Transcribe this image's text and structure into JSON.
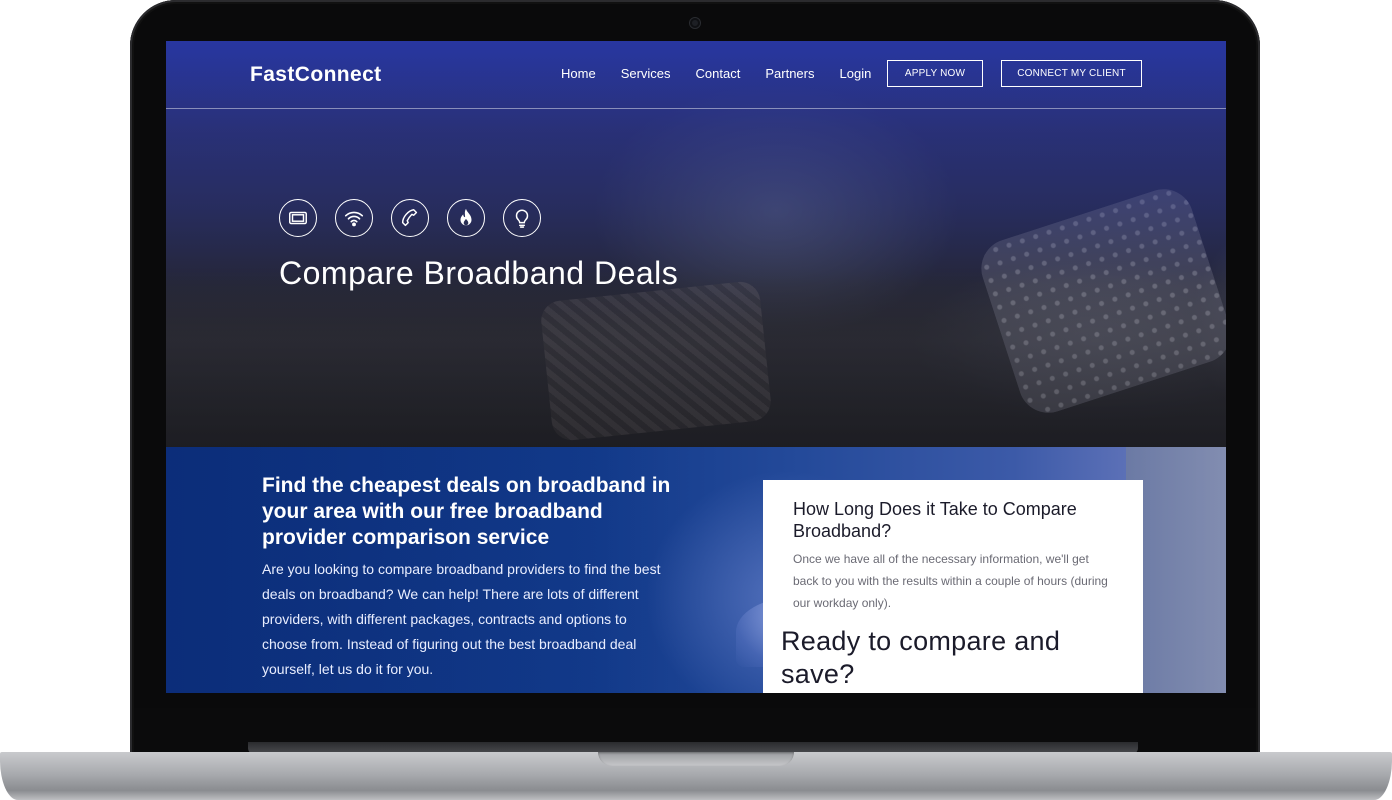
{
  "brand": {
    "logo": "FastConnect"
  },
  "nav": {
    "links": [
      "Home",
      "Services",
      "Contact",
      "Partners",
      "Login"
    ],
    "apply_button": "APPLY NOW",
    "connect_button": "CONNECT MY CLIENT"
  },
  "hero": {
    "icons": [
      "tv-icon",
      "wifi-icon",
      "phone-icon",
      "flame-icon",
      "lightbulb-icon"
    ],
    "title": "Compare Broadband Deals"
  },
  "intro": {
    "heading": "Find the cheapest deals on broadband in your area with our free broadband provider comparison service",
    "paragraph": "Are you looking to compare broadband providers to find the best deals on broadband? We can help! There are lots of different providers, with different packages, contracts and options to choose from. Instead of figuring out the best broadband deal yourself, let us do it for you."
  },
  "card": {
    "title": "How Long Does it Take to Compare Broadband?",
    "text": "Once we have all of the necessary information, we'll get back to you with the results within a couple of hours (during our workday only).",
    "cta": "Ready to compare and save?"
  },
  "colors": {
    "nav_overlay": "#2838aa",
    "lower_bg": "#0c2f7a",
    "card_bg": "#ffffff"
  }
}
